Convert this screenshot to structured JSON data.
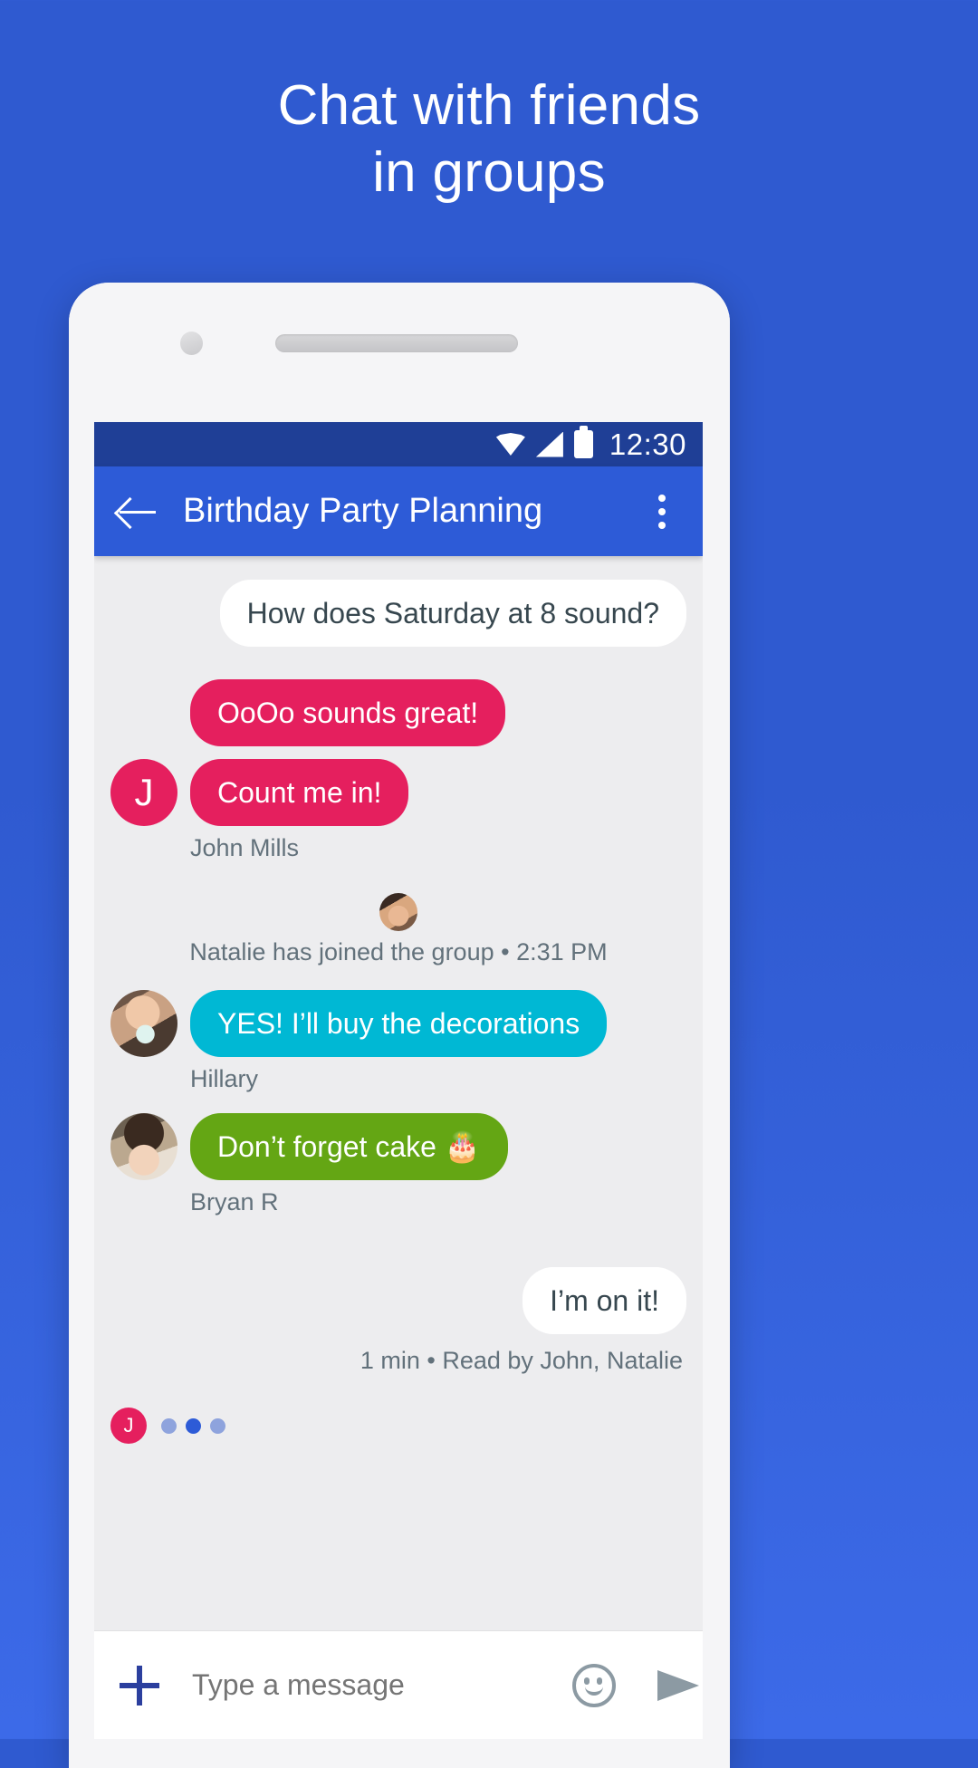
{
  "headline": {
    "line1": "Chat with friends",
    "line2": "in groups"
  },
  "status_bar": {
    "time": "12:30",
    "icons": [
      "wifi-icon",
      "cell-signal-icon",
      "battery-icon"
    ]
  },
  "app_bar": {
    "back_label": "",
    "title": "Birthday Party Planning",
    "overflow_label": ""
  },
  "messages": [
    {
      "id": "m1",
      "text": "How does Saturday at 8 sound?",
      "side": "out",
      "color": "white",
      "sender": ""
    },
    {
      "id": "m2",
      "text": "OoOo sounds great!",
      "side": "in",
      "color": "pink",
      "sender": ""
    },
    {
      "id": "m3",
      "text": "Count me in!",
      "side": "in",
      "color": "pink",
      "sender": "John Mills",
      "avatar_initial": "J"
    },
    {
      "id": "m4",
      "text": "YES! I’ll buy the decorations",
      "side": "in",
      "color": "cyan",
      "sender": "Hillary"
    },
    {
      "id": "m5",
      "text": "Don’t forget cake 🎂",
      "side": "in",
      "color": "green",
      "sender": "Bryan R"
    },
    {
      "id": "m6",
      "text": "I’m on it!",
      "side": "out",
      "color": "white",
      "sender": ""
    }
  ],
  "join_notice": {
    "text": "Natalie has joined the group • 2:31 PM"
  },
  "read_receipt": {
    "text": "1 min • Read by John, Natalie"
  },
  "typing_indicator": {
    "initial": "J",
    "dots": 3
  },
  "composer": {
    "placeholder": "Type a message",
    "value": "",
    "add_label": "",
    "emoji_label": "",
    "send_label": ""
  },
  "colors": {
    "background": "#2f5ad0",
    "app_bar": "#2d5bd7",
    "status_bar": "#1f3f96",
    "bubble_pink": "#e51f5e",
    "bubble_cyan": "#00b8d4",
    "bubble_green": "#64a614",
    "bubble_white": "#ffffff",
    "screen_bg": "#ededef"
  }
}
